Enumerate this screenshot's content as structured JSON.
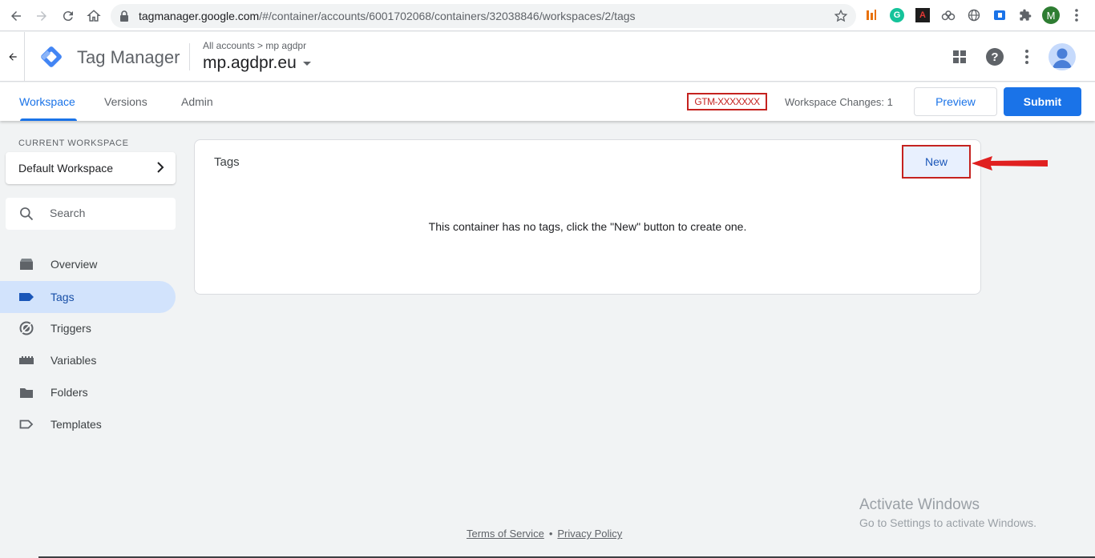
{
  "browser": {
    "url_host": "tagmanager.google.com",
    "url_path": "/#/container/accounts/6001702068/containers/32038846/workspaces/2/tags",
    "profile_initial": "M"
  },
  "header": {
    "product_name": "Tag Manager",
    "breadcrumb_accounts": "All accounts",
    "breadcrumb_separator": ">",
    "breadcrumb_account": "mp agdpr",
    "container_name": "mp.agdpr.eu"
  },
  "tabs": {
    "workspace": "Workspace",
    "versions": "Versions",
    "admin": "Admin"
  },
  "toolbar": {
    "container_id": "GTM-XXXXXXX",
    "workspace_changes": "Workspace Changes: 1",
    "preview_label": "Preview",
    "submit_label": "Submit"
  },
  "sidebar": {
    "current_workspace_label": "CURRENT WORKSPACE",
    "workspace_name": "Default Workspace",
    "search_placeholder": "Search",
    "items": [
      {
        "label": "Overview",
        "icon": "overview-icon",
        "active": false
      },
      {
        "label": "Tags",
        "icon": "tag-icon",
        "active": true
      },
      {
        "label": "Triggers",
        "icon": "trigger-icon",
        "active": false
      },
      {
        "label": "Variables",
        "icon": "variables-icon",
        "active": false
      },
      {
        "label": "Folders",
        "icon": "folder-icon",
        "active": false
      },
      {
        "label": "Templates",
        "icon": "template-icon",
        "active": false
      }
    ]
  },
  "main": {
    "card_title": "Tags",
    "new_label": "New",
    "empty_message": "This container has no tags, click the \"New\" button to create one."
  },
  "footer": {
    "terms": "Terms of Service",
    "separator": "•",
    "privacy": "Privacy Policy"
  },
  "watermark": {
    "title": "Activate Windows",
    "subtitle": "Go to Settings to activate Windows."
  },
  "colors": {
    "accent": "#1a73e8",
    "highlight_red": "#c5221f",
    "active_nav_bg": "#d2e3fc"
  }
}
